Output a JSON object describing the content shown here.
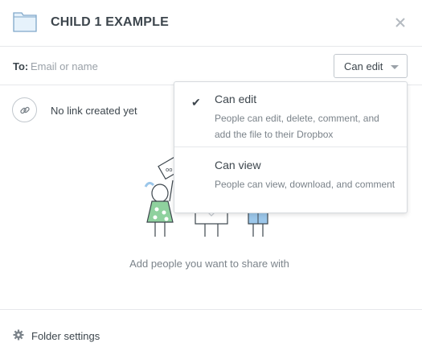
{
  "header": {
    "title": "CHILD 1 EXAMPLE",
    "folder_icon": "folder-icon",
    "close_icon": "close-icon"
  },
  "to_row": {
    "label": "To:",
    "placeholder": "Email or name",
    "value": "",
    "permission_button_label": "Can edit"
  },
  "link_row": {
    "icon": "link-icon",
    "text": "No link created yet"
  },
  "empty_state": {
    "text": "Add people you want to share with"
  },
  "footer": {
    "icon": "gear-icon",
    "label": "Folder settings"
  },
  "permission_menu": {
    "options": [
      {
        "title": "Can edit",
        "description": "People can edit, delete, comment, and add the file to their Dropbox",
        "selected": true
      },
      {
        "title": "Can view",
        "description": "People can view, download, and comment",
        "selected": false
      }
    ],
    "check_glyph": "✔"
  },
  "colors": {
    "folder_fill": "#e6f2fb",
    "folder_stroke": "#7fa7c9",
    "figure_green": "#8fd19e",
    "figure_blue": "#9cc7ea",
    "border": "#e6e8eb",
    "text_muted": "#7b838a",
    "text": "#3d464d"
  }
}
